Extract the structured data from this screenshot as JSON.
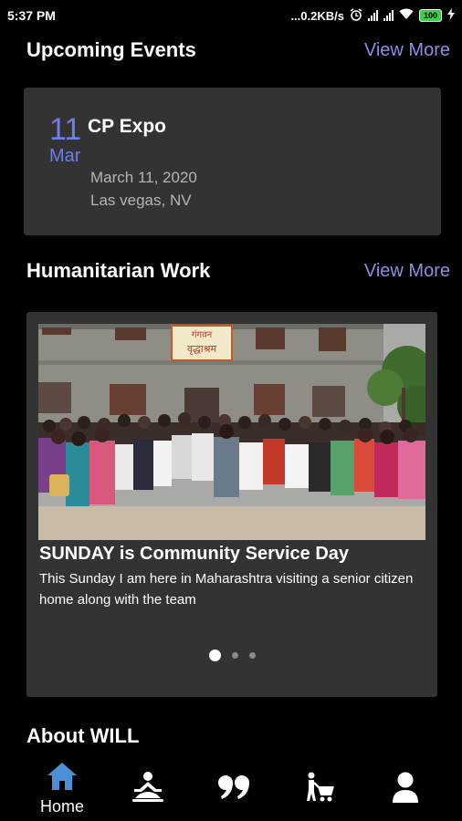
{
  "status_bar": {
    "time": "5:37 PM",
    "network_speed": "...0.2KB/s",
    "battery_level": "100"
  },
  "upcoming_events": {
    "title": "Upcoming Events",
    "view_more": "View More",
    "event": {
      "day": "11",
      "month": "Mar",
      "title": "CP Expo",
      "date": "March 11, 2020",
      "location": "Las vegas, NV"
    }
  },
  "humanitarian_work": {
    "title": "Humanitarian Work",
    "view_more": "View More",
    "slide": {
      "title": "SUNDAY is Community Service Day",
      "description": "This Sunday I am here in Maharashtra visiting a senior citizen home along with the team",
      "building_sign": "गंगवन वृद्धाश्रम"
    },
    "carousel": {
      "count": 3,
      "active_index": 0
    }
  },
  "about": {
    "title": "About WILL"
  },
  "bottom_nav": {
    "items": [
      {
        "icon": "home-icon",
        "label": "Home",
        "active": true
      },
      {
        "icon": "meditation-icon",
        "label": ""
      },
      {
        "icon": "quote-icon",
        "label": ""
      },
      {
        "icon": "shopping-cart-icon",
        "label": ""
      },
      {
        "icon": "profile-icon",
        "label": ""
      }
    ]
  },
  "colors": {
    "accent": "#6f7ee8",
    "link": "#8d8ee6",
    "card": "#333333",
    "nav_active": "#4a90d9"
  }
}
